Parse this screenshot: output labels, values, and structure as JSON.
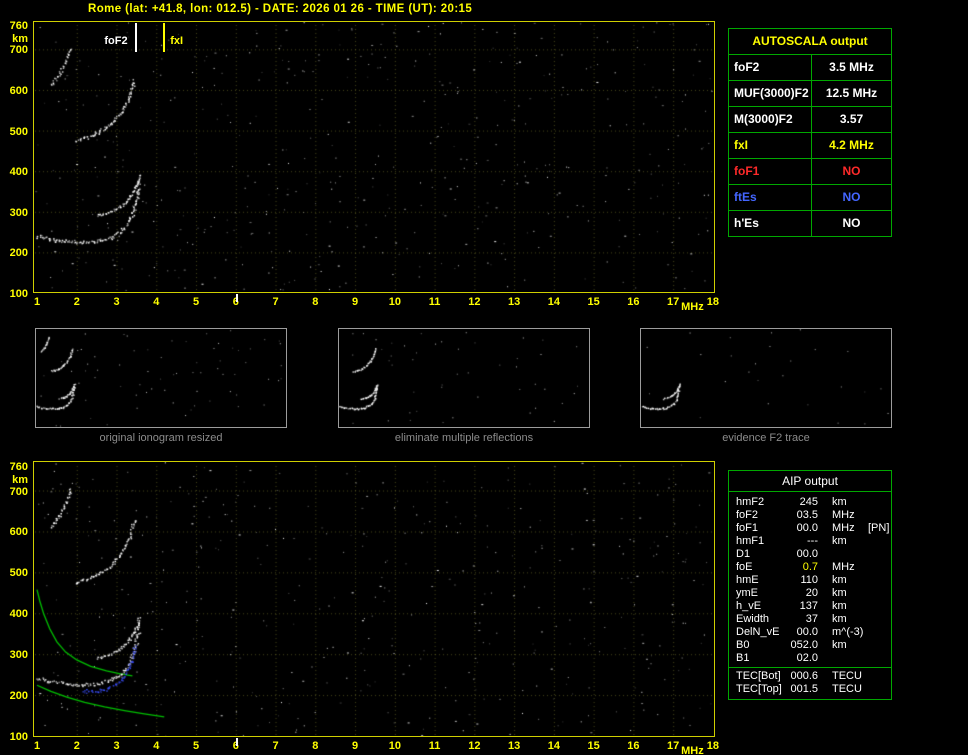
{
  "header": {
    "title": "Rome (lat: +41.8, lon: 012.5) - DATE: 2026 01 26 - TIME (UT): 20:15"
  },
  "axes": {
    "y_ticks": [
      760,
      700,
      600,
      500,
      400,
      300,
      200,
      100
    ],
    "y_unit": "km",
    "x_ticks": [
      1,
      2,
      3,
      4,
      5,
      6,
      7,
      8,
      9,
      10,
      11,
      12,
      13,
      14,
      15,
      16,
      17,
      18
    ],
    "x_unit": "MHz"
  },
  "top_plot": {
    "markers": [
      {
        "label": "foF2",
        "freq": 3.5,
        "color": "#ffffff",
        "side": "left"
      },
      {
        "label": "fxI",
        "freq": 4.2,
        "color": "#ffff00",
        "side": "right"
      }
    ],
    "trace_keys": [
      "hop1",
      "xmode",
      "hop2",
      "hop3"
    ],
    "lines": []
  },
  "bottom_plot": {
    "markers": [],
    "trace_keys": [
      "hop1",
      "xmode",
      "hop2",
      "hop3",
      "restored"
    ],
    "lines": [
      "profile_upper",
      "profile_lower"
    ]
  },
  "traces": {
    "hop1": {
      "rgb": "255,255,255",
      "w": 2.4,
      "points": [
        [
          1.0,
          242
        ],
        [
          1.3,
          234
        ],
        [
          1.7,
          228
        ],
        [
          2.1,
          226
        ],
        [
          2.5,
          229
        ],
        [
          2.8,
          236
        ],
        [
          3.0,
          246
        ],
        [
          3.2,
          262
        ],
        [
          3.35,
          286
        ],
        [
          3.45,
          315
        ],
        [
          3.52,
          350
        ],
        [
          3.57,
          392
        ]
      ]
    },
    "xmode": {
      "rgb": "255,255,255",
      "w": 1.8,
      "points": [
        [
          2.5,
          292
        ],
        [
          2.8,
          300
        ],
        [
          3.05,
          311
        ],
        [
          3.25,
          328
        ],
        [
          3.42,
          352
        ],
        [
          3.53,
          378
        ]
      ]
    },
    "hop2": {
      "rgb": "255,255,255",
      "w": 2.0,
      "points": [
        [
          1.95,
          476
        ],
        [
          2.25,
          484
        ],
        [
          2.55,
          497
        ],
        [
          2.85,
          517
        ],
        [
          3.1,
          545
        ],
        [
          3.3,
          582
        ],
        [
          3.45,
          630
        ]
      ]
    },
    "hop3": {
      "rgb": "255,255,255",
      "w": 1.8,
      "points": [
        [
          1.35,
          612
        ],
        [
          1.55,
          640
        ],
        [
          1.72,
          672
        ],
        [
          1.85,
          706
        ]
      ]
    },
    "restored": {
      "rgb": "60,80,255",
      "w": 2.2,
      "points": [
        [
          2.15,
          210
        ],
        [
          2.5,
          211
        ],
        [
          2.8,
          219
        ],
        [
          3.05,
          233
        ],
        [
          3.25,
          256
        ],
        [
          3.38,
          285
        ],
        [
          3.47,
          318
        ]
      ]
    }
  },
  "lines": {
    "profile_upper": {
      "color": "#00c000",
      "points": [
        [
          1.0,
          458
        ],
        [
          1.07,
          430
        ],
        [
          1.17,
          398
        ],
        [
          1.32,
          362
        ],
        [
          1.5,
          330
        ],
        [
          1.72,
          305
        ],
        [
          2.0,
          286
        ],
        [
          2.35,
          270
        ],
        [
          2.75,
          259
        ],
        [
          3.1,
          252
        ],
        [
          3.4,
          247
        ]
      ]
    },
    "profile_lower": {
      "color": "#00c000",
      "points": [
        [
          1.0,
          224
        ],
        [
          1.35,
          209
        ],
        [
          1.75,
          195
        ],
        [
          2.2,
          182
        ],
        [
          2.7,
          171
        ],
        [
          3.2,
          162
        ],
        [
          3.7,
          154
        ],
        [
          4.2,
          147
        ]
      ]
    }
  },
  "autoscala_table": {
    "title": "AUTOSCALA output",
    "rows": [
      {
        "param": "foF2",
        "value": "3.5 MHz",
        "color": "#ffffff"
      },
      {
        "param": "MUF(3000)F2",
        "value": "12.5 MHz",
        "color": "#ffffff"
      },
      {
        "param": "M(3000)F2",
        "value": "3.57",
        "color": "#ffffff"
      },
      {
        "param": "fxI",
        "value": "4.2 MHz",
        "color": "#ffff00"
      },
      {
        "param": "foF1",
        "value": "NO",
        "color": "#ff2a2a"
      },
      {
        "param": "ftEs",
        "value": "NO",
        "color": "#4466ff"
      },
      {
        "param": "h'Es",
        "value": "NO",
        "color": "#ffffff"
      }
    ]
  },
  "thumbnails": [
    {
      "caption": "original ionogram resized",
      "trace_keys": [
        "hop1",
        "xmode",
        "hop2",
        "hop3"
      ],
      "noise": 70
    },
    {
      "caption": "eliminate multiple reflections",
      "trace_keys": [
        "hop1",
        "xmode",
        "hop2"
      ],
      "noise": 48
    },
    {
      "caption": "evidence F2 trace",
      "trace_keys": [
        "hop1",
        "xmode"
      ],
      "noise": 26
    }
  ],
  "aip_table": {
    "title": "AIP output",
    "rows": [
      {
        "param": "hmF2",
        "value": "245",
        "unit": "km",
        "note": ""
      },
      {
        "param": "foF2",
        "value": "03.5",
        "unit": "MHz",
        "note": ""
      },
      {
        "param": "foF1",
        "value": "00.0",
        "unit": "MHz",
        "note": "[PN]"
      },
      {
        "param": "hmF1",
        "value": "---",
        "unit": "km",
        "note": ""
      },
      {
        "param": "D1",
        "value": "00.0",
        "unit": "",
        "note": ""
      },
      {
        "param": "foE",
        "value": "0.7",
        "unit": "MHz",
        "note": "",
        "color": "#ffff00"
      },
      {
        "param": "hmE",
        "value": "110",
        "unit": "km",
        "note": ""
      },
      {
        "param": "ymE",
        "value": "20",
        "unit": "km",
        "note": ""
      },
      {
        "param": "h_vE",
        "value": "137",
        "unit": "km",
        "note": ""
      },
      {
        "param": "Ewidth",
        "value": "37",
        "unit": "km",
        "note": ""
      },
      {
        "param": "DelN_vE",
        "value": "00.0",
        "unit": "m^(-3)",
        "note": ""
      },
      {
        "param": "B0",
        "value": "052.0",
        "unit": "km",
        "note": ""
      },
      {
        "param": "B1",
        "value": "02.0",
        "unit": "",
        "note": ""
      }
    ],
    "tec_rows": [
      {
        "param": "TEC[Bot]",
        "value": "000.6",
        "unit": "TECU"
      },
      {
        "param": "TEC[Top]",
        "value": "001.5",
        "unit": "TECU"
      }
    ]
  },
  "misc": {
    "interference_freq": 6.0
  }
}
